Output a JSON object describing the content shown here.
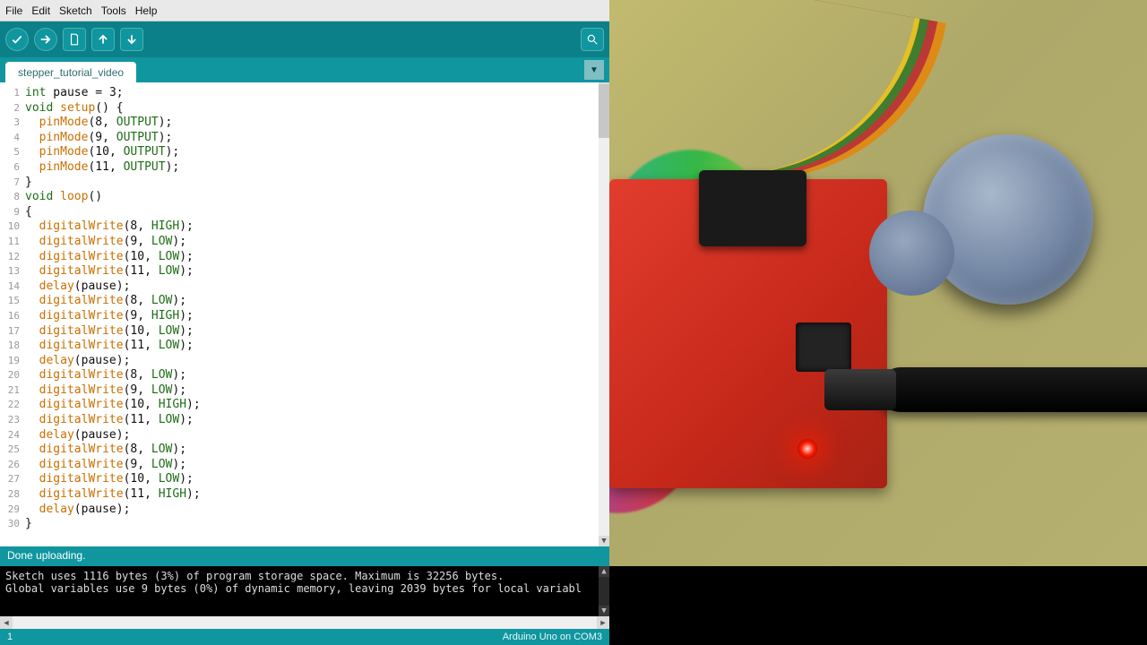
{
  "menu": {
    "file": "File",
    "edit": "Edit",
    "sketch": "Sketch",
    "tools": "Tools",
    "help": "Help"
  },
  "toolbar_icons": {
    "verify": "verify-icon",
    "upload": "upload-icon",
    "new": "new-icon",
    "open": "open-icon",
    "save": "save-icon",
    "serial": "serial-monitor-icon"
  },
  "tab": {
    "name": "stepper_tutorial_video"
  },
  "code": [
    {
      "n": 1,
      "t": [
        [
          "kw",
          "int"
        ],
        [
          "plain",
          " pause "
        ],
        [
          "plain",
          "= "
        ],
        [
          "num",
          "3"
        ],
        [
          "plain",
          ";"
        ]
      ]
    },
    {
      "n": 2,
      "t": [
        [
          "kw",
          "void"
        ],
        [
          "plain",
          " "
        ],
        [
          "fn",
          "setup"
        ],
        [
          "plain",
          "() {"
        ]
      ]
    },
    {
      "n": 3,
      "t": [
        [
          "plain",
          "  "
        ],
        [
          "fn",
          "pinMode"
        ],
        [
          "plain",
          "("
        ],
        [
          "num",
          "8"
        ],
        [
          "plain",
          ", "
        ],
        [
          "cst",
          "OUTPUT"
        ],
        [
          "plain",
          ");"
        ]
      ]
    },
    {
      "n": 4,
      "t": [
        [
          "plain",
          "  "
        ],
        [
          "fn",
          "pinMode"
        ],
        [
          "plain",
          "("
        ],
        [
          "num",
          "9"
        ],
        [
          "plain",
          ", "
        ],
        [
          "cst",
          "OUTPUT"
        ],
        [
          "plain",
          ");"
        ]
      ]
    },
    {
      "n": 5,
      "t": [
        [
          "plain",
          "  "
        ],
        [
          "fn",
          "pinMode"
        ],
        [
          "plain",
          "("
        ],
        [
          "num",
          "10"
        ],
        [
          "plain",
          ", "
        ],
        [
          "cst",
          "OUTPUT"
        ],
        [
          "plain",
          ");"
        ]
      ]
    },
    {
      "n": 6,
      "t": [
        [
          "plain",
          "  "
        ],
        [
          "fn",
          "pinMode"
        ],
        [
          "plain",
          "("
        ],
        [
          "num",
          "11"
        ],
        [
          "plain",
          ", "
        ],
        [
          "cst",
          "OUTPUT"
        ],
        [
          "plain",
          ");"
        ]
      ]
    },
    {
      "n": 7,
      "t": [
        [
          "plain",
          "}"
        ]
      ]
    },
    {
      "n": 8,
      "t": [
        [
          "kw",
          "void"
        ],
        [
          "plain",
          " "
        ],
        [
          "fn",
          "loop"
        ],
        [
          "plain",
          "()"
        ]
      ]
    },
    {
      "n": 9,
      "t": [
        [
          "plain",
          "{"
        ]
      ]
    },
    {
      "n": 10,
      "t": [
        [
          "plain",
          "  "
        ],
        [
          "fn",
          "digitalWrite"
        ],
        [
          "plain",
          "("
        ],
        [
          "num",
          "8"
        ],
        [
          "plain",
          ", "
        ],
        [
          "cst",
          "HIGH"
        ],
        [
          "plain",
          ");"
        ]
      ]
    },
    {
      "n": 11,
      "t": [
        [
          "plain",
          "  "
        ],
        [
          "fn",
          "digitalWrite"
        ],
        [
          "plain",
          "("
        ],
        [
          "num",
          "9"
        ],
        [
          "plain",
          ", "
        ],
        [
          "cst",
          "LOW"
        ],
        [
          "plain",
          ");"
        ]
      ]
    },
    {
      "n": 12,
      "t": [
        [
          "plain",
          "  "
        ],
        [
          "fn",
          "digitalWrite"
        ],
        [
          "plain",
          "("
        ],
        [
          "num",
          "10"
        ],
        [
          "plain",
          ", "
        ],
        [
          "cst",
          "LOW"
        ],
        [
          "plain",
          ");"
        ]
      ]
    },
    {
      "n": 13,
      "t": [
        [
          "plain",
          "  "
        ],
        [
          "fn",
          "digitalWrite"
        ],
        [
          "plain",
          "("
        ],
        [
          "num",
          "11"
        ],
        [
          "plain",
          ", "
        ],
        [
          "cst",
          "LOW"
        ],
        [
          "plain",
          ");"
        ]
      ]
    },
    {
      "n": 14,
      "t": [
        [
          "plain",
          "  "
        ],
        [
          "fn",
          "delay"
        ],
        [
          "plain",
          "(pause);"
        ]
      ]
    },
    {
      "n": 15,
      "t": [
        [
          "plain",
          "  "
        ],
        [
          "fn",
          "digitalWrite"
        ],
        [
          "plain",
          "("
        ],
        [
          "num",
          "8"
        ],
        [
          "plain",
          ", "
        ],
        [
          "cst",
          "LOW"
        ],
        [
          "plain",
          ");"
        ]
      ]
    },
    {
      "n": 16,
      "t": [
        [
          "plain",
          "  "
        ],
        [
          "fn",
          "digitalWrite"
        ],
        [
          "plain",
          "("
        ],
        [
          "num",
          "9"
        ],
        [
          "plain",
          ", "
        ],
        [
          "cst",
          "HIGH"
        ],
        [
          "plain",
          ");"
        ]
      ]
    },
    {
      "n": 17,
      "t": [
        [
          "plain",
          "  "
        ],
        [
          "fn",
          "digitalWrite"
        ],
        [
          "plain",
          "("
        ],
        [
          "num",
          "10"
        ],
        [
          "plain",
          ", "
        ],
        [
          "cst",
          "LOW"
        ],
        [
          "plain",
          ");"
        ]
      ]
    },
    {
      "n": 18,
      "t": [
        [
          "plain",
          "  "
        ],
        [
          "fn",
          "digitalWrite"
        ],
        [
          "plain",
          "("
        ],
        [
          "num",
          "11"
        ],
        [
          "plain",
          ", "
        ],
        [
          "cst",
          "LOW"
        ],
        [
          "plain",
          ");"
        ]
      ]
    },
    {
      "n": 19,
      "t": [
        [
          "plain",
          "  "
        ],
        [
          "fn",
          "delay"
        ],
        [
          "plain",
          "(pause);"
        ]
      ]
    },
    {
      "n": 20,
      "t": [
        [
          "plain",
          "  "
        ],
        [
          "fn",
          "digitalWrite"
        ],
        [
          "plain",
          "("
        ],
        [
          "num",
          "8"
        ],
        [
          "plain",
          ", "
        ],
        [
          "cst",
          "LOW"
        ],
        [
          "plain",
          ");"
        ]
      ]
    },
    {
      "n": 21,
      "t": [
        [
          "plain",
          "  "
        ],
        [
          "fn",
          "digitalWrite"
        ],
        [
          "plain",
          "("
        ],
        [
          "num",
          "9"
        ],
        [
          "plain",
          ", "
        ],
        [
          "cst",
          "LOW"
        ],
        [
          "plain",
          ");"
        ]
      ]
    },
    {
      "n": 22,
      "t": [
        [
          "plain",
          "  "
        ],
        [
          "fn",
          "digitalWrite"
        ],
        [
          "plain",
          "("
        ],
        [
          "num",
          "10"
        ],
        [
          "plain",
          ", "
        ],
        [
          "cst",
          "HIGH"
        ],
        [
          "plain",
          ");"
        ]
      ]
    },
    {
      "n": 23,
      "t": [
        [
          "plain",
          "  "
        ],
        [
          "fn",
          "digitalWrite"
        ],
        [
          "plain",
          "("
        ],
        [
          "num",
          "11"
        ],
        [
          "plain",
          ", "
        ],
        [
          "cst",
          "LOW"
        ],
        [
          "plain",
          ");"
        ]
      ]
    },
    {
      "n": 24,
      "t": [
        [
          "plain",
          "  "
        ],
        [
          "fn",
          "delay"
        ],
        [
          "plain",
          "(pause);"
        ]
      ]
    },
    {
      "n": 25,
      "t": [
        [
          "plain",
          "  "
        ],
        [
          "fn",
          "digitalWrite"
        ],
        [
          "plain",
          "("
        ],
        [
          "num",
          "8"
        ],
        [
          "plain",
          ", "
        ],
        [
          "cst",
          "LOW"
        ],
        [
          "plain",
          ");"
        ]
      ]
    },
    {
      "n": 26,
      "t": [
        [
          "plain",
          "  "
        ],
        [
          "fn",
          "digitalWrite"
        ],
        [
          "plain",
          "("
        ],
        [
          "num",
          "9"
        ],
        [
          "plain",
          ", "
        ],
        [
          "cst",
          "LOW"
        ],
        [
          "plain",
          ");"
        ]
      ]
    },
    {
      "n": 27,
      "t": [
        [
          "plain",
          "  "
        ],
        [
          "fn",
          "digitalWrite"
        ],
        [
          "plain",
          "("
        ],
        [
          "num",
          "10"
        ],
        [
          "plain",
          ", "
        ],
        [
          "cst",
          "LOW"
        ],
        [
          "plain",
          ");"
        ]
      ]
    },
    {
      "n": 28,
      "t": [
        [
          "plain",
          "  "
        ],
        [
          "fn",
          "digitalWrite"
        ],
        [
          "plain",
          "("
        ],
        [
          "num",
          "11"
        ],
        [
          "plain",
          ", "
        ],
        [
          "cst",
          "HIGH"
        ],
        [
          "plain",
          ");"
        ]
      ]
    },
    {
      "n": 29,
      "t": [
        [
          "plain",
          "  "
        ],
        [
          "fn",
          "delay"
        ],
        [
          "plain",
          "(pause);"
        ]
      ]
    },
    {
      "n": 30,
      "t": [
        [
          "plain",
          "}"
        ]
      ]
    }
  ],
  "status": {
    "text": "Done uploading."
  },
  "console": {
    "line1": "Sketch uses 1116 bytes (3%) of program storage space. Maximum is 32256 bytes.",
    "line2": "Global variables use 9 bytes (0%) of dynamic memory, leaving 2039 bytes for local variabl"
  },
  "footer": {
    "left": "1",
    "right": "Arduino Uno on COM3"
  }
}
